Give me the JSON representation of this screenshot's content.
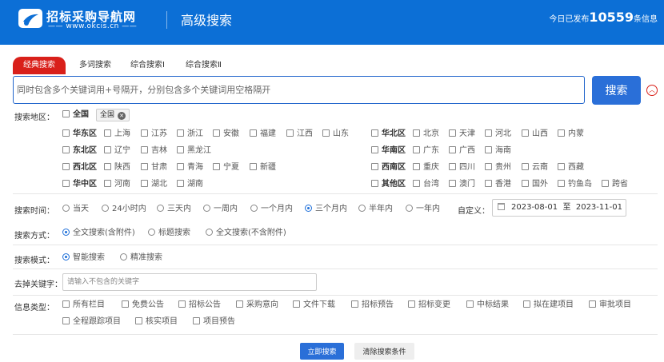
{
  "header": {
    "logo_name": "招标采购导航网",
    "logo_url": "www.okcis.cn",
    "title": "高级搜索",
    "stat_prefix": "今日已发布",
    "stat_count": "10559",
    "stat_suffix": "条信息",
    "brand_color": "#0c6fd6"
  },
  "tabs": [
    "经典搜索",
    "多词搜索",
    "综合搜索Ⅰ",
    "综合搜索Ⅱ"
  ],
  "search": {
    "placeholder": "同时包含多个关键词用+号隔开，分别包含多个关键词用空格隔开",
    "button": "搜索",
    "collapse_icon": "chevron-up-icon"
  },
  "region": {
    "label": "搜索地区：",
    "all_label": "全国",
    "chip": "全国",
    "left_groups": [
      {
        "name": "华东区",
        "items": [
          "上海",
          "江苏",
          "浙江",
          "安徽",
          "福建",
          "江西",
          "山东"
        ]
      },
      {
        "name": "东北区",
        "items": [
          "辽宁",
          "吉林",
          "黑龙江"
        ]
      },
      {
        "name": "西北区",
        "items": [
          "陕西",
          "甘肃",
          "青海",
          "宁夏",
          "新疆"
        ]
      },
      {
        "name": "华中区",
        "items": [
          "河南",
          "湖北",
          "湖南"
        ]
      }
    ],
    "right_groups": [
      {
        "name": "华北区",
        "items": [
          "北京",
          "天津",
          "河北",
          "山西",
          "内蒙"
        ]
      },
      {
        "name": "华南区",
        "items": [
          "广东",
          "广西",
          "海南"
        ]
      },
      {
        "name": "西南区",
        "items": [
          "重庆",
          "四川",
          "贵州",
          "云南",
          "西藏"
        ]
      },
      {
        "name": "其他区",
        "items": [
          "台湾",
          "澳门",
          "香港",
          "国外",
          "钓鱼岛",
          "跨省"
        ]
      }
    ]
  },
  "time": {
    "label": "搜索时间：",
    "options": [
      "当天",
      "24小时内",
      "三天内",
      "一周内",
      "一个月内",
      "三个月内",
      "半年内",
      "一年内"
    ],
    "selected": "三个月内",
    "custom_label": "自定义：",
    "date_from": "2023-08-01",
    "date_to_label": "至",
    "date_to": "2023-11-01"
  },
  "method": {
    "label": "搜索方式：",
    "options": [
      "全文搜索(含附件)",
      "标题搜索",
      "全文搜索(不含附件)"
    ],
    "selected": "全文搜索(含附件)"
  },
  "mode": {
    "label": "搜索模式：",
    "options": [
      "智能搜索",
      "精准搜索"
    ],
    "selected": "智能搜索"
  },
  "exclude": {
    "label": "去掉关键字：",
    "placeholder": "请输入不包含的关键字"
  },
  "info_type": {
    "label": "信息类型：",
    "row1": [
      "所有栏目",
      "免费公告",
      "招标公告",
      "采购意向",
      "文件下载",
      "招标预告",
      "招标变更",
      "中标结果",
      "拟在建项目",
      "审批项目"
    ],
    "row2": [
      "全程跟踪项目",
      "核实项目",
      "项目预告"
    ]
  },
  "actions": {
    "submit": "立即搜索",
    "clear": "清除搜索条件"
  }
}
